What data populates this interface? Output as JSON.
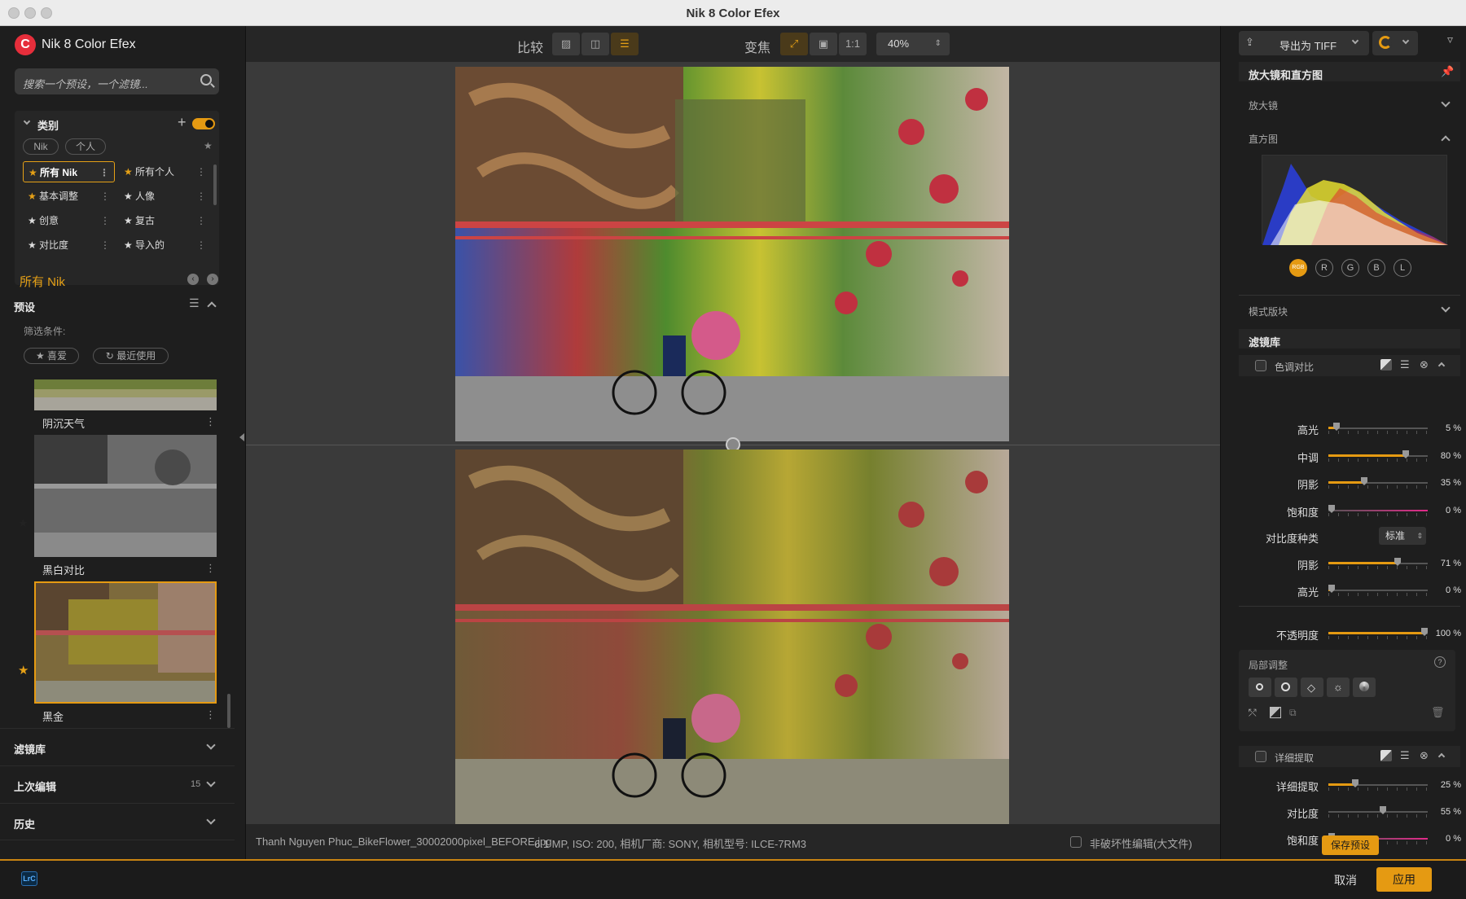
{
  "window": {
    "title": "Nik 8 Color Efex"
  },
  "app": {
    "name": "Nik 8 Color Efex",
    "logo_letter": "C"
  },
  "search": {
    "placeholder": "搜索一个预设，一个滤镜..."
  },
  "categories": {
    "header": "类别",
    "pills": [
      "Nik",
      "个人"
    ],
    "items": [
      {
        "label": "所有 Nik",
        "starred": true,
        "active": true
      },
      {
        "label": "所有个人",
        "starred": true,
        "active": false
      },
      {
        "label": "基本调整",
        "starred": true,
        "active": false
      },
      {
        "label": "人像",
        "starred": false,
        "active": false
      },
      {
        "label": "创意",
        "starred": false,
        "active": false
      },
      {
        "label": "复古",
        "starred": false,
        "active": false
      },
      {
        "label": "对比度",
        "starred": false,
        "active": false
      },
      {
        "label": "导入的",
        "starred": false,
        "active": false
      }
    ]
  },
  "current_collection": "所有 Nik",
  "presets": {
    "header": "预设",
    "filter_label": "筛选条件:",
    "filters": [
      "喜爱",
      "最近使用"
    ],
    "items": [
      {
        "label": "阴沉天气"
      },
      {
        "label": "黑白对比"
      },
      {
        "label": "黑金"
      }
    ]
  },
  "left_sections": {
    "filter_library": "滤镜库",
    "last_edit": "上次编辑",
    "last_edit_count": "15",
    "history": "历史"
  },
  "toolbar": {
    "compare_label": "比较",
    "zoom_label": "变焦",
    "one_to_one": "1:1",
    "zoom_value": "40%"
  },
  "status": {
    "filename": "Thanh Nguyen Phuc_BikeFlower_30002000pixel_BEFORE.jpg",
    "meta": "6.1 MP, ISO: 200, 相机厂商: SONY, 相机型号: ILCE-7RM3",
    "nondestructive": "非破坏性编辑(大文件)"
  },
  "right": {
    "export": "导出为 TIFF",
    "loupe_hist_header": "放大镜和直方图",
    "loupe": "放大镜",
    "histogram": "直方图",
    "channels": [
      "RGB",
      "R",
      "G",
      "B",
      "L"
    ],
    "blend_mode": "模式版块",
    "filter_library": "滤镜库",
    "filter1": {
      "name": "色调对比",
      "sliders": [
        {
          "label": "高光",
          "value": 5,
          "text": "5 %"
        },
        {
          "label": "中调",
          "value": 80,
          "text": "80 %"
        },
        {
          "label": "阴影",
          "value": 35,
          "text": "35 %"
        },
        {
          "label": "饱和度",
          "value": 0,
          "text": "0 %"
        }
      ],
      "contrast_type_label": "对比度种类",
      "contrast_type_value": "标准",
      "sliders2": [
        {
          "label": "阴影",
          "value": 71,
          "text": "71 %"
        },
        {
          "label": "高光",
          "value": 0,
          "text": "0 %"
        }
      ],
      "opacity_label": "不透明度",
      "opacity_value": 100,
      "opacity_text": "100 %",
      "local_adjust": "局部调整"
    },
    "filter2": {
      "name": "详细提取",
      "sliders": [
        {
          "label": "详细提取",
          "value": 25,
          "text": "25 %"
        },
        {
          "label": "对比度",
          "value": 55,
          "text": "55 %"
        },
        {
          "label": "饱和度",
          "value": 0,
          "text": "0 %"
        }
      ]
    },
    "save_preset": "保存预设"
  },
  "bottom": {
    "host": "LrC",
    "cancel": "取消",
    "apply": "应用"
  },
  "colors": {
    "accent": "#e59a12",
    "logo": "#e62e3b"
  }
}
